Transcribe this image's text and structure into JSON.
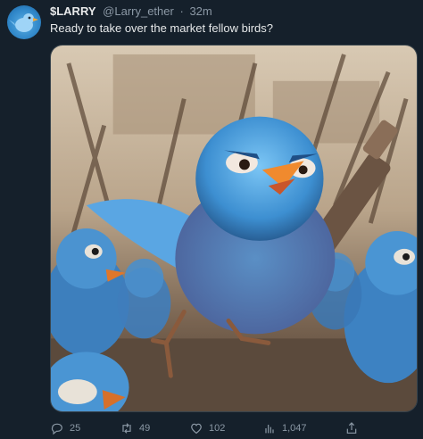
{
  "tweet": {
    "display_name": "$LARRY",
    "handle": "@Larry_ether",
    "separator": "·",
    "time": "32m",
    "text": "Ready to take over the market fellow birds?"
  },
  "actions": {
    "replies": "25",
    "retweets": "49",
    "likes": "102",
    "views": "1,047"
  },
  "colors": {
    "background": "#15202b",
    "text": "#e7e9ea",
    "muted": "#8b98a5",
    "bird_blue": "#4a9fe0"
  },
  "icons": [
    "bird-avatar-icon",
    "reply-icon",
    "retweet-icon",
    "like-icon",
    "views-icon",
    "share-icon"
  ]
}
